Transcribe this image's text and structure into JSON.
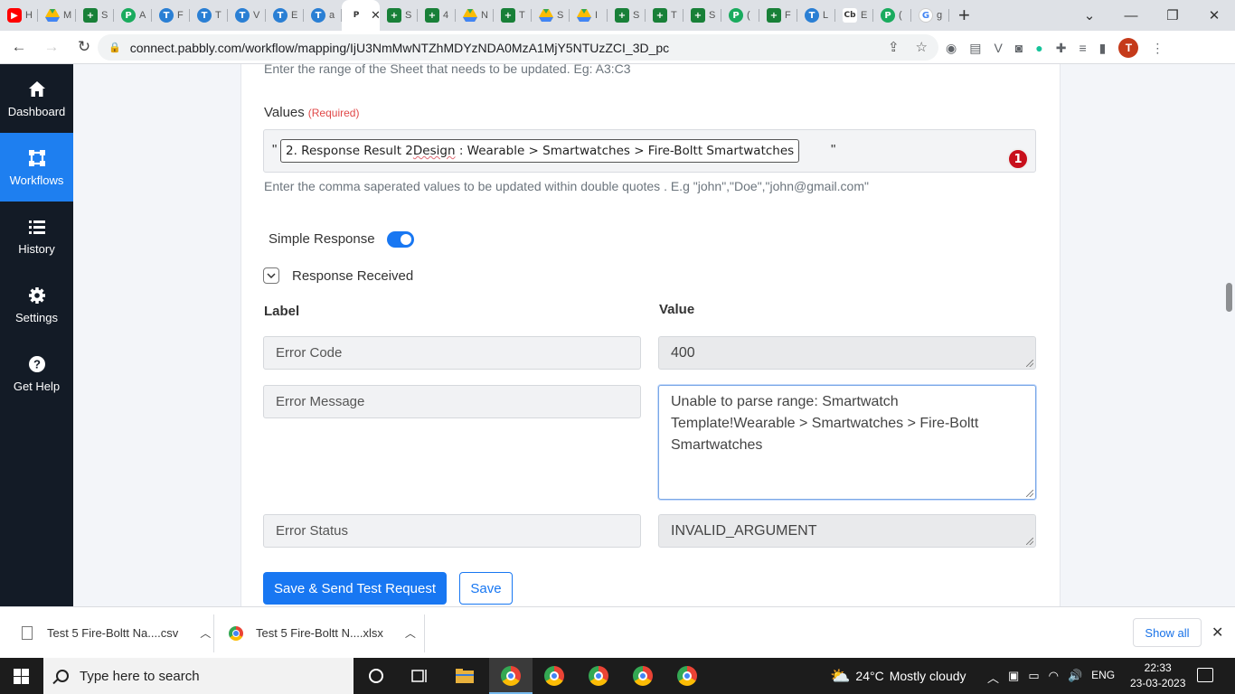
{
  "browser": {
    "tabs": [
      {
        "favicon": "youtube-icon",
        "kind": "yt",
        "glyph": "▶",
        "title": "H"
      },
      {
        "favicon": "google-drive-icon",
        "kind": "gd",
        "glyph": "▲",
        "title": "M"
      },
      {
        "favicon": "sheets-icon",
        "kind": "sh",
        "glyph": "+",
        "title": "S"
      },
      {
        "favicon": "pabbly-icon",
        "kind": "pb",
        "glyph": "P",
        "title": "A"
      },
      {
        "favicon": "template-icon",
        "kind": "tt2",
        "glyph": "T",
        "title": "F"
      },
      {
        "favicon": "template-icon",
        "kind": "tt2",
        "glyph": "T",
        "title": "T"
      },
      {
        "favicon": "template-icon",
        "kind": "tt2",
        "glyph": "T",
        "title": "V"
      },
      {
        "favicon": "template-icon",
        "kind": "tt2",
        "glyph": "T",
        "title": "E"
      },
      {
        "favicon": "template-icon",
        "kind": "tt2",
        "glyph": "T",
        "title": "a"
      },
      {
        "favicon": "pabbly-icon",
        "kind": "cb",
        "glyph": "P",
        "title": "Pa",
        "active": true
      },
      {
        "favicon": "sheets-icon",
        "kind": "sh",
        "glyph": "+",
        "title": "S"
      },
      {
        "favicon": "sheets-icon",
        "kind": "sh",
        "glyph": "+",
        "title": "4"
      },
      {
        "favicon": "google-drive-icon",
        "kind": "gd",
        "glyph": "▲",
        "title": "N"
      },
      {
        "favicon": "sheets-icon",
        "kind": "sh",
        "glyph": "+",
        "title": "T"
      },
      {
        "favicon": "google-drive-icon",
        "kind": "gd",
        "glyph": "▲",
        "title": "S"
      },
      {
        "favicon": "google-drive-icon",
        "kind": "gd",
        "glyph": "▲",
        "title": "I"
      },
      {
        "favicon": "sheets-icon",
        "kind": "sh",
        "glyph": "+",
        "title": "S"
      },
      {
        "favicon": "sheets-icon",
        "kind": "sh",
        "glyph": "+",
        "title": "T"
      },
      {
        "favicon": "sheets-icon",
        "kind": "sh",
        "glyph": "+",
        "title": "S"
      },
      {
        "favicon": "pabbly-icon",
        "kind": "pb",
        "glyph": "P",
        "title": "("
      },
      {
        "favicon": "sheets-icon",
        "kind": "sh",
        "glyph": "+",
        "title": "F"
      },
      {
        "favicon": "template-icon",
        "kind": "tt2",
        "glyph": "T",
        "title": "L"
      },
      {
        "favicon": "cb-icon",
        "kind": "cb",
        "glyph": "Cb",
        "title": "E"
      },
      {
        "favicon": "pabbly-icon",
        "kind": "pb",
        "glyph": "P",
        "title": "("
      },
      {
        "favicon": "google-icon",
        "kind": "go",
        "glyph": "G",
        "title": "g"
      }
    ],
    "url": "connect.pabbly.com/workflow/mapping/IjU3NmMwNTZhMDYzNDA0MzA1MjY5NTUzZCI_3D_pc",
    "profile_initial": "T"
  },
  "sidebar": {
    "items": [
      {
        "label": "Dashboard",
        "icon": "home-icon"
      },
      {
        "label": "Workflows",
        "icon": "workflow-icon",
        "active": true
      },
      {
        "label": "History",
        "icon": "history-icon"
      },
      {
        "label": "Settings",
        "icon": "gear-icon"
      },
      {
        "label": "Get Help",
        "icon": "help-icon"
      }
    ]
  },
  "form": {
    "range_hint": "Enter the range of the Sheet that needs to be updated. Eg: A3:C3",
    "values_label": "Values",
    "values_required": "(Required)",
    "values_quote_open": "\"",
    "values_chip_pre": "2. Response Result 2 ",
    "values_chip_misspelled": "Design",
    "values_chip_post": " : Wearable > Smartwatches > Fire-Boltt Smartwatches",
    "values_quote_close": "\"",
    "values_badge": "1",
    "values_hint": "Enter the comma saperated values to be updated within double quotes . E.g \"john\",\"Doe\",\"john@gmail.com\"",
    "simple_response_label": "Simple Response",
    "simple_response_on": true,
    "response_received_label": "Response Received",
    "col_label": "Label",
    "col_value": "Value",
    "rows": [
      {
        "label": "Error Code",
        "value": "400"
      },
      {
        "label": "Error Message",
        "value": "Unable to parse range: Smartwatch Template!Wearable > Smartwatches > Fire-Boltt Smartwatches"
      },
      {
        "label": "Error Status",
        "value": "INVALID_ARGUMENT"
      }
    ],
    "save_send_button": "Save & Send Test Request",
    "save_button": "Save"
  },
  "downloads": {
    "items": [
      {
        "name": "Test 5 Fire-Boltt Na....csv",
        "icon": "file-icon"
      },
      {
        "name": "Test 5 Fire-Boltt N....xlsx",
        "icon": "chrome-icon"
      }
    ],
    "show_all": "Show all"
  },
  "taskbar": {
    "search_placeholder": "Type here to search",
    "weather_temp": "24°C",
    "weather_desc": "Mostly cloudy",
    "lang": "ENG",
    "time": "22:33",
    "date": "23-03-2023"
  }
}
